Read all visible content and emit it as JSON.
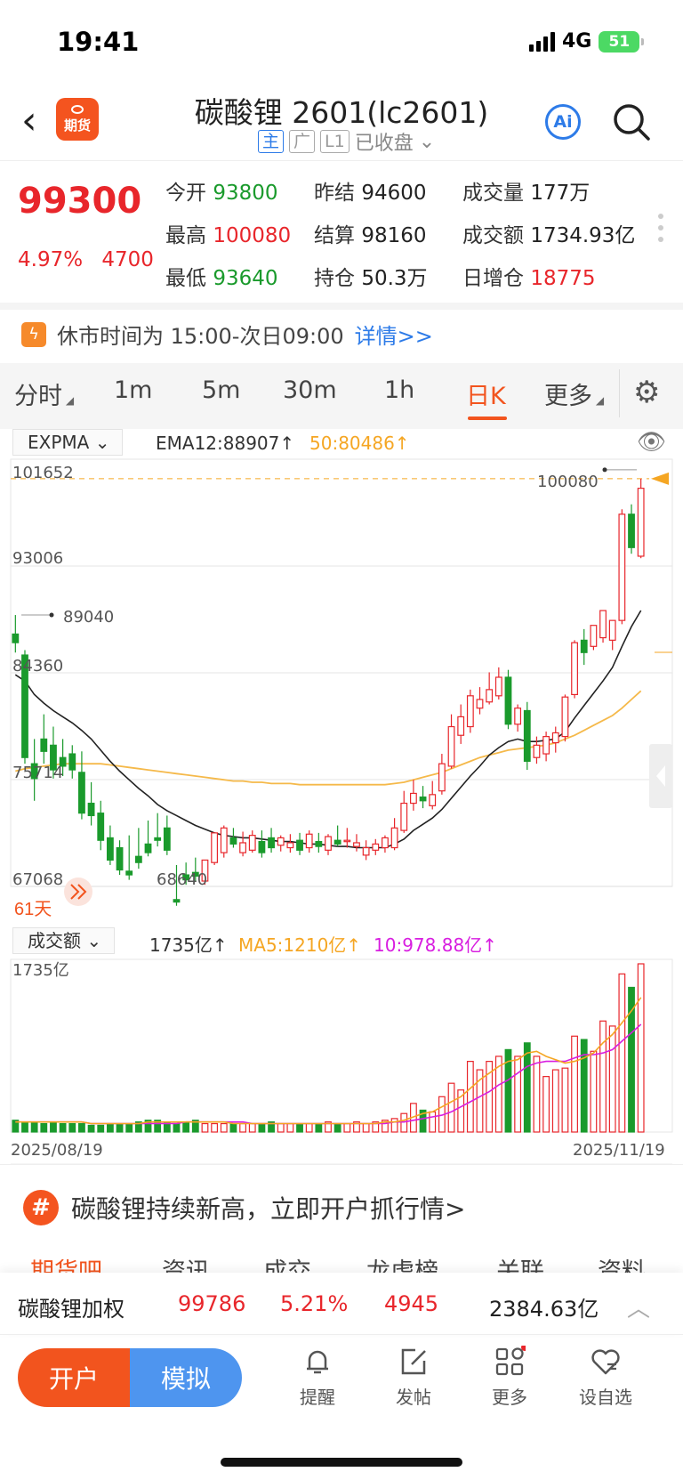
{
  "status_bar": {
    "time": "19:41",
    "network": "4G",
    "battery": "51"
  },
  "header": {
    "logo_text": "期货",
    "title": "碳酸锂 2601(lc2601)",
    "tags": [
      "主",
      "广",
      "L1"
    ],
    "market_state": "已收盘"
  },
  "quote": {
    "price": "99300",
    "change_pct": "4.97%",
    "change": "4700",
    "open_label": "今开",
    "open": "93800",
    "prev_settle_label": "昨结",
    "prev_settle": "94600",
    "volume_label": "成交量",
    "volume": "177万",
    "high_label": "最高",
    "high": "100080",
    "settle_label": "结算",
    "settle": "98160",
    "turnover_label": "成交额",
    "turnover": "1734.93亿",
    "low_label": "最低",
    "low": "93640",
    "oi_label": "持仓",
    "oi": "50.3万",
    "oi_change_label": "日增仓",
    "oi_change": "18775"
  },
  "notice": {
    "text": "休市时间为 15:00-次日09:00",
    "more": "详情>>"
  },
  "tabs": [
    "分时",
    "1m",
    "5m",
    "30m",
    "1h",
    "日K",
    "更多"
  ],
  "active_tab": "日K",
  "indicator": {
    "name": "EXPMA",
    "ema12": "EMA12:88907↑",
    "ema50": "50:80486↑"
  },
  "volume_indicator": {
    "name": "成交额",
    "value": "1735亿↑",
    "ma5": "MA5:1210亿↑",
    "ma10": "10:978.88亿↑"
  },
  "chart_data": {
    "type": "candlestick",
    "y_ticks": [
      "101652",
      "93006",
      "84360",
      "75714",
      "67068"
    ],
    "ylim": [
      67068,
      101652
    ],
    "max_label": "100080",
    "min_label": "68640",
    "left_marker": "89040",
    "period_label": "61天",
    "volume_max_label": "1735亿",
    "x_start": "2025/08/19",
    "x_end": "2025/11/19",
    "colors": {
      "up": "#e8262b",
      "down": "#1a9a2c",
      "ema12": "#222222",
      "ema50": "#f5b94a",
      "ma5": "#f5a623",
      "ma10": "#d81ee0"
    },
    "candles": [
      [
        87500,
        89040,
        86800,
        86000
      ],
      [
        85800,
        86200,
        77500,
        77000
      ],
      [
        77000,
        79000,
        75800,
        74000
      ],
      [
        79000,
        81000,
        78000,
        77000
      ],
      [
        78500,
        80000,
        76500,
        75800
      ],
      [
        77500,
        79000,
        76800,
        76000
      ],
      [
        77800,
        78500,
        76500,
        75800
      ],
      [
        76300,
        78000,
        73000,
        72500
      ],
      [
        73800,
        75500,
        72800,
        72000
      ],
      [
        73000,
        74000,
        70800,
        70000
      ],
      [
        71000,
        72000,
        69200,
        68800
      ],
      [
        70200,
        70800,
        68400,
        68000
      ],
      [
        68300,
        71200,
        68000,
        67600
      ],
      [
        69500,
        71800,
        69000,
        68500
      ],
      [
        70500,
        72400,
        69800,
        69500
      ],
      [
        71000,
        73000,
        70800,
        70300
      ],
      [
        71800,
        72800,
        70000,
        69600
      ],
      [
        66000,
        68800,
        65800,
        65500
      ],
      [
        68000,
        69000,
        67600,
        67200
      ],
      [
        68200,
        69400,
        67900,
        67500
      ],
      [
        67500,
        68800,
        69200,
        67200
      ],
      [
        69000,
        70000,
        71400,
        68800
      ],
      [
        69800,
        72000,
        71800,
        69400
      ],
      [
        71000,
        71800,
        70500,
        70200
      ],
      [
        69800,
        71500,
        70600,
        69500
      ],
      [
        70000,
        71600,
        71200,
        69800
      ],
      [
        70700,
        71600,
        69800,
        69400
      ],
      [
        71000,
        71800,
        70200,
        69800
      ],
      [
        70400,
        71200,
        71000,
        69900
      ],
      [
        70200,
        71300,
        70600,
        69800
      ],
      [
        70800,
        71400,
        70000,
        69600
      ],
      [
        70200,
        71600,
        71300,
        69800
      ],
      [
        70700,
        71400,
        70300,
        69800
      ],
      [
        70000,
        71300,
        71100,
        69600
      ],
      [
        70800,
        72000,
        70500,
        70300
      ],
      [
        70700,
        71800,
        70800,
        70200
      ],
      [
        70300,
        71300,
        70600,
        69900
      ],
      [
        69600,
        70800,
        70200,
        69200
      ],
      [
        70000,
        70900,
        70500,
        69600
      ],
      [
        70200,
        71200,
        71000,
        69800
      ],
      [
        70200,
        72600,
        71800,
        70000
      ],
      [
        71600,
        74800,
        73800,
        71400
      ],
      [
        73800,
        75700,
        74600,
        73200
      ],
      [
        74300,
        75200,
        74000,
        73400
      ],
      [
        73600,
        75600,
        74500,
        73300
      ],
      [
        74800,
        77800,
        77000,
        74500
      ],
      [
        76800,
        81000,
        80000,
        76600
      ],
      [
        79300,
        81800,
        80800,
        78600
      ],
      [
        80000,
        83000,
        82500,
        79500
      ],
      [
        81500,
        83200,
        82200,
        81000
      ],
      [
        82000,
        84400,
        83000,
        81800
      ],
      [
        82500,
        84800,
        84000,
        82200
      ],
      [
        84000,
        84600,
        80200,
        79800
      ],
      [
        80200,
        81800,
        81500,
        79600
      ],
      [
        81300,
        82000,
        77200,
        76500
      ],
      [
        77500,
        79200,
        78500,
        77000
      ],
      [
        77800,
        79600,
        79200,
        77200
      ],
      [
        78700,
        80000,
        79500,
        77900
      ],
      [
        79200,
        82600,
        82400,
        78800
      ],
      [
        82600,
        87000,
        86800,
        82300
      ],
      [
        87000,
        87900,
        86000,
        85000
      ],
      [
        86500,
        88000,
        88200,
        86200
      ],
      [
        87200,
        88800,
        89400,
        86800
      ],
      [
        87000,
        87800,
        88600,
        86200
      ],
      [
        88600,
        97600,
        97200,
        88300
      ],
      [
        97200,
        98000,
        94500,
        94000
      ],
      [
        93800,
        100080,
        99300,
        93640
      ]
    ],
    "ema12": [
      84200,
      83700,
      82600,
      81900,
      81300,
      80800,
      80300,
      79700,
      79000,
      78100,
      77200,
      76400,
      75700,
      75000,
      74400,
      73700,
      73200,
      72800,
      72400,
      72000,
      71700,
      71400,
      71200,
      71100,
      71000,
      71000,
      70900,
      70800,
      70700,
      70700,
      70600,
      70500,
      70500,
      70400,
      70300,
      70300,
      70200,
      70200,
      70200,
      70200,
      70500,
      70900,
      71600,
      72100,
      72600,
      73300,
      74200,
      75100,
      76000,
      76800,
      77700,
      78300,
      78800,
      79000,
      78800,
      78800,
      78900,
      79000,
      79600,
      80700,
      81700,
      82700,
      83700,
      84800,
      86500,
      88100,
      89400
    ],
    "ema50": [
      76400,
      76600,
      76700,
      76800,
      76900,
      77000,
      77000,
      77000,
      77000,
      77000,
      76900,
      76800,
      76700,
      76600,
      76500,
      76400,
      76300,
      76200,
      76100,
      76000,
      75900,
      75800,
      75700,
      75600,
      75600,
      75500,
      75500,
      75400,
      75400,
      75400,
      75300,
      75300,
      75300,
      75300,
      75300,
      75300,
      75300,
      75300,
      75300,
      75300,
      75400,
      75500,
      75700,
      75900,
      76100,
      76300,
      76600,
      76900,
      77200,
      77500,
      77700,
      77900,
      78100,
      78200,
      78300,
      78400,
      78500,
      78700,
      79000,
      79300,
      79700,
      80100,
      80500,
      80900,
      81500,
      82200,
      82900
    ],
    "volume": [
      0.07,
      0.06,
      0.06,
      0.05,
      0.06,
      0.05,
      0.05,
      0.05,
      0.04,
      0.04,
      0.05,
      0.05,
      0.05,
      0.06,
      0.07,
      0.07,
      0.06,
      0.05,
      0.06,
      0.07,
      0.05,
      0.05,
      0.05,
      0.05,
      0.05,
      0.05,
      0.05,
      0.06,
      0.05,
      0.05,
      0.05,
      0.05,
      0.05,
      0.06,
      0.05,
      0.05,
      0.06,
      0.05,
      0.06,
      0.07,
      0.08,
      0.11,
      0.17,
      0.13,
      0.12,
      0.21,
      0.29,
      0.25,
      0.42,
      0.37,
      0.42,
      0.45,
      0.49,
      0.45,
      0.53,
      0.45,
      0.33,
      0.37,
      0.38,
      0.57,
      0.55,
      0.48,
      0.66,
      0.63,
      0.94,
      0.86,
      1.0
    ],
    "ma5": [
      0.06,
      0.06,
      0.06,
      0.06,
      0.06,
      0.06,
      0.06,
      0.06,
      0.05,
      0.05,
      0.05,
      0.05,
      0.05,
      0.05,
      0.06,
      0.06,
      0.06,
      0.06,
      0.06,
      0.06,
      0.06,
      0.06,
      0.06,
      0.05,
      0.05,
      0.05,
      0.05,
      0.05,
      0.05,
      0.05,
      0.05,
      0.05,
      0.05,
      0.05,
      0.05,
      0.05,
      0.05,
      0.05,
      0.05,
      0.06,
      0.06,
      0.07,
      0.09,
      0.11,
      0.12,
      0.15,
      0.18,
      0.21,
      0.26,
      0.31,
      0.35,
      0.39,
      0.42,
      0.43,
      0.47,
      0.48,
      0.45,
      0.43,
      0.41,
      0.42,
      0.44,
      0.47,
      0.53,
      0.58,
      0.65,
      0.72,
      0.8
    ],
    "ma10": [
      0.06,
      0.06,
      0.06,
      0.06,
      0.06,
      0.06,
      0.06,
      0.06,
      0.05,
      0.05,
      0.05,
      0.05,
      0.05,
      0.05,
      0.05,
      0.05,
      0.05,
      0.05,
      0.06,
      0.06,
      0.06,
      0.06,
      0.06,
      0.06,
      0.06,
      0.05,
      0.05,
      0.05,
      0.05,
      0.05,
      0.05,
      0.05,
      0.05,
      0.05,
      0.05,
      0.05,
      0.05,
      0.05,
      0.05,
      0.05,
      0.06,
      0.06,
      0.07,
      0.08,
      0.09,
      0.1,
      0.12,
      0.15,
      0.18,
      0.21,
      0.24,
      0.28,
      0.31,
      0.35,
      0.39,
      0.41,
      0.42,
      0.42,
      0.42,
      0.44,
      0.46,
      0.46,
      0.47,
      0.49,
      0.54,
      0.59,
      0.64
    ]
  },
  "banner": {
    "text": "碳酸锂持续新高，立即开户抓行情>"
  },
  "section_tabs": [
    "期货吧",
    "资讯",
    "成交",
    "龙虎榜",
    "关联",
    "资料"
  ],
  "weighted": {
    "name": "碳酸锂加权",
    "price": "99786",
    "pct": "5.21%",
    "change": "4945",
    "turnover": "2384.63亿"
  },
  "bottom_nav": {
    "open_account": "开户",
    "simulate": "模拟",
    "items": [
      "提醒",
      "发帖",
      "更多",
      "设自选"
    ]
  }
}
